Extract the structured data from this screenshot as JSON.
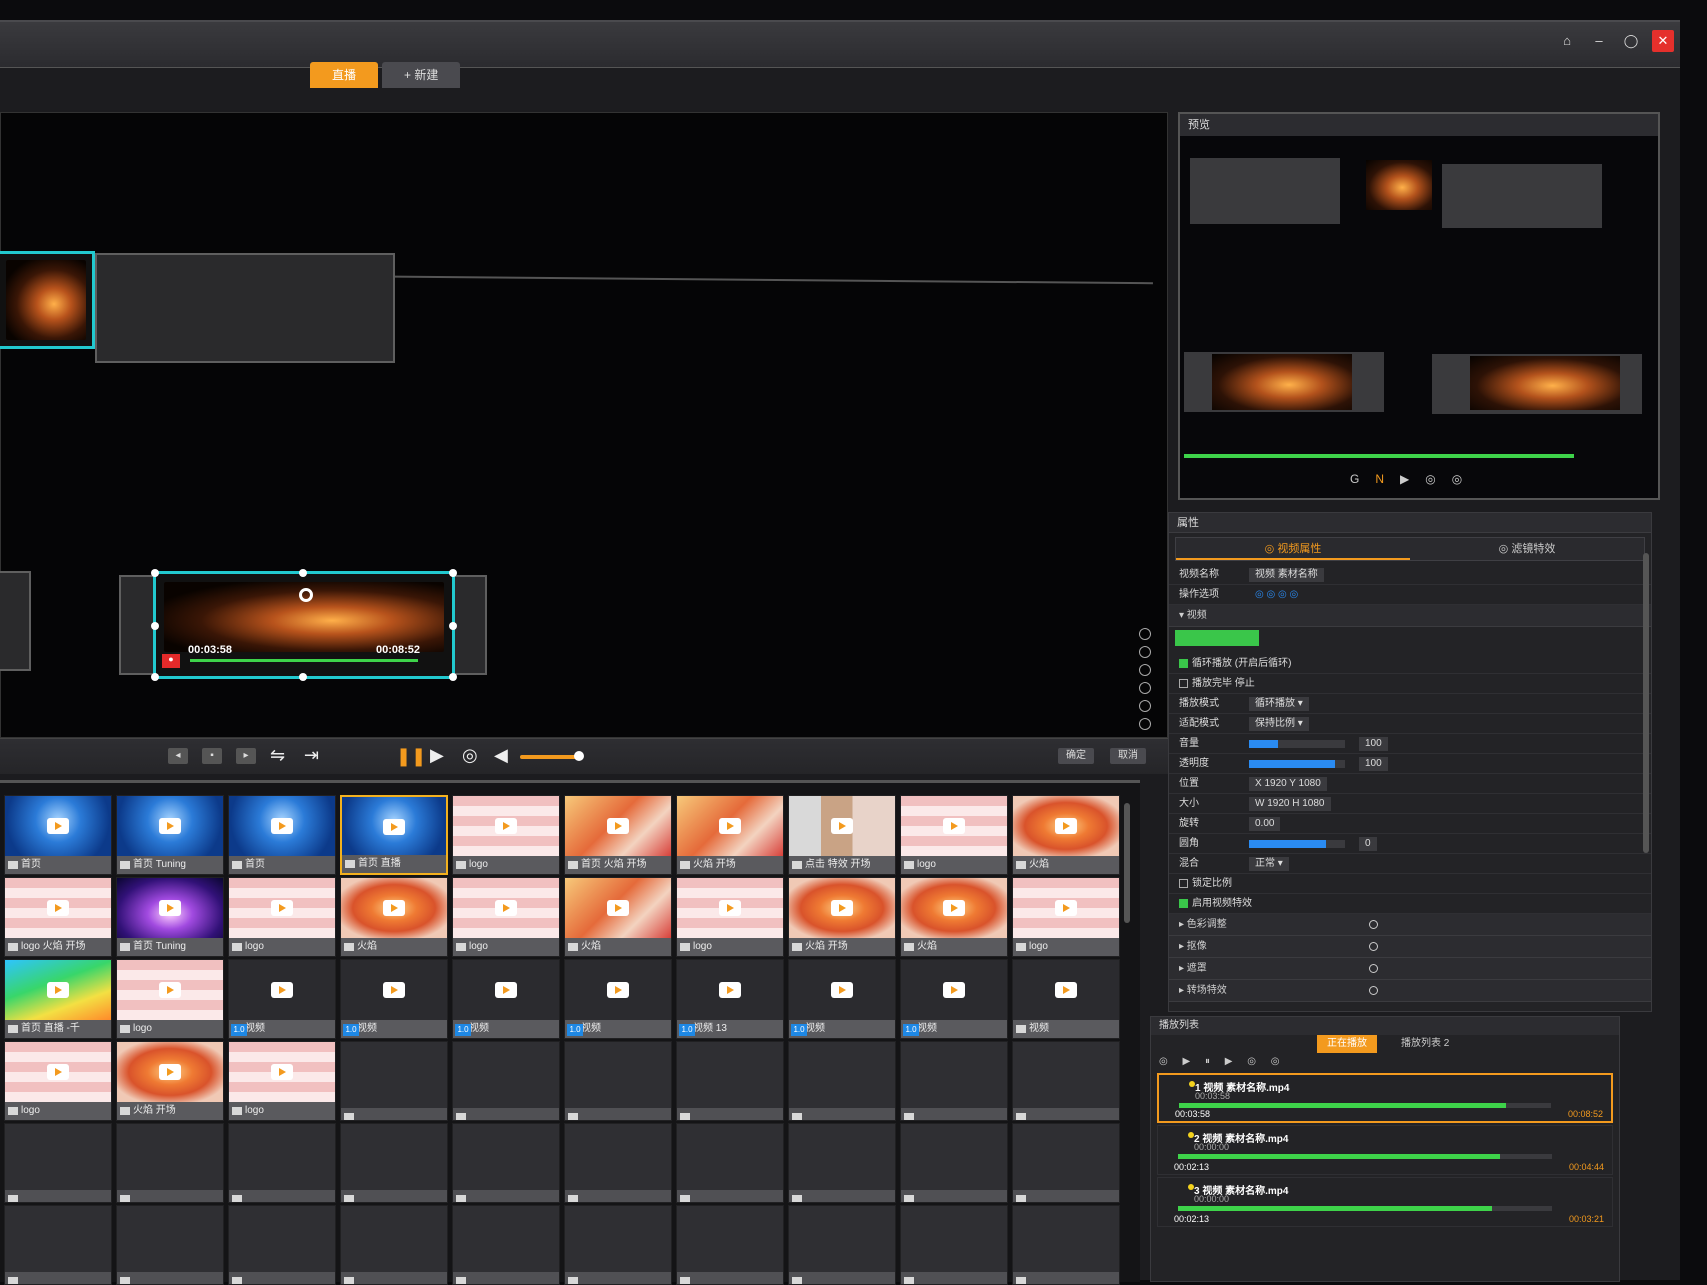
{
  "titlebar": {
    "tabs": [
      {
        "label": "直播"
      },
      {
        "label": "+ 新建"
      }
    ],
    "window_controls": [
      "minimize",
      "restore",
      "close"
    ]
  },
  "stage": {
    "selected_clip": {
      "time_left": "00:03:58",
      "time_right": "00:08:52"
    }
  },
  "transport": {
    "buttons_right": [
      "确定",
      "取消"
    ]
  },
  "media": {
    "items": [
      {
        "label": "首页",
        "art": "blue"
      },
      {
        "label": "首页 Tuning",
        "art": "blue"
      },
      {
        "label": "首页",
        "art": "blue"
      },
      {
        "label": "首页 直播",
        "art": "blue",
        "selected": true
      },
      {
        "label": "logo",
        "art": "pinkstripe"
      },
      {
        "label": "首页 火焰 开场",
        "art": "flame"
      },
      {
        "label": "火焰 开场",
        "art": "flame"
      },
      {
        "label": "点击 特效 开场",
        "art": "mix"
      },
      {
        "label": "logo",
        "art": "pinkstripe"
      },
      {
        "label": "火焰",
        "art": "torch"
      },
      {
        "label": "logo 火焰 开场",
        "art": "pinkstripe"
      },
      {
        "label": "首页 Tuning",
        "art": "purple"
      },
      {
        "label": "logo",
        "art": "pinkstripe"
      },
      {
        "label": "火焰",
        "art": "torch"
      },
      {
        "label": "logo",
        "art": "pinkstripe"
      },
      {
        "label": "火焰",
        "art": "flame"
      },
      {
        "label": "logo",
        "art": "pinkstripe"
      },
      {
        "label": "火焰 开场",
        "art": "torch"
      },
      {
        "label": "火焰",
        "art": "torch"
      },
      {
        "label": "logo",
        "art": "pinkstripe"
      },
      {
        "label": "首页 直播 -千",
        "art": "rainbow"
      },
      {
        "label": "logo",
        "art": "pinkstripe"
      },
      {
        "label": "视频",
        "art": "dark",
        "badge": "1.0"
      },
      {
        "label": "视频",
        "art": "dark",
        "badge": "1.0"
      },
      {
        "label": "视频",
        "art": "dark",
        "badge": "1.0"
      },
      {
        "label": "视频",
        "art": "dark",
        "badge": "1.0"
      },
      {
        "label": "视频 13",
        "art": "dark",
        "badge": "1.0"
      },
      {
        "label": "视频",
        "art": "dark",
        "badge": "1.0"
      },
      {
        "label": "视频",
        "art": "dark",
        "badge": "1.0"
      },
      {
        "label": "视频",
        "art": "dark"
      },
      {
        "label": "logo",
        "art": "pinkstripe"
      },
      {
        "label": "火焰 开场",
        "art": "torch"
      },
      {
        "label": "logo",
        "art": "pinkstripe"
      }
    ]
  },
  "preview": {
    "title": "预览",
    "tool_icons": [
      "G",
      "N",
      "▶",
      "◎",
      "◎"
    ]
  },
  "props": {
    "title": "属性",
    "tabs": [
      "◎ 视频属性",
      "◎ 滤镜特效"
    ],
    "rows": [
      {
        "label": "视频名称",
        "value": "视频 素材名称"
      },
      {
        "label": "操作选项",
        "value": "◎ ◎ ◎ ◎"
      }
    ],
    "section_label": "▾ 视频",
    "checks": [
      {
        "label": "循环播放 (开启后循环)",
        "on": true
      },
      {
        "label": "播放完毕 停止",
        "on": false
      }
    ],
    "settings": [
      {
        "label": "播放模式",
        "value": "循环播放 ▾"
      },
      {
        "label": "适配模式",
        "value": "保持比例 ▾"
      },
      {
        "label": "音量",
        "slider": 0.3,
        "value": "100"
      },
      {
        "label": "透明度",
        "slider": 0.9,
        "value": "100"
      },
      {
        "label": "位置",
        "value": "X 1920   Y 1080"
      },
      {
        "label": "大小",
        "value": "W 1920   H 1080"
      },
      {
        "label": "旋转",
        "value": "0.00"
      },
      {
        "label": "圆角",
        "slider": 0.8,
        "value": "0"
      },
      {
        "label": "混合",
        "value": "正常 ▾"
      }
    ],
    "checks2": [
      {
        "label": "锁定比例",
        "on": false
      },
      {
        "label": "启用视频特效",
        "on": true
      }
    ],
    "sections": [
      "▸ 色彩调整",
      "▸ 抠像",
      "▸ 遮罩",
      "▸ 转场特效"
    ]
  },
  "playlist": {
    "title": "播放列表",
    "tabs": [
      "正在播放",
      "播放列表 2"
    ],
    "tools": "◎ ▶ ⏸ ▶ ◎ ◎",
    "items": [
      {
        "name": "1 视频 素材名称.mp4",
        "sub": "00:03:58",
        "time": "00:03:58",
        "time2": "00:08:52",
        "progress": 0.88,
        "active": true
      },
      {
        "name": "2 视频 素材名称.mp4",
        "sub": "00:00:00",
        "time": "00:02:13",
        "time2": "00:04:44",
        "progress": 0.86,
        "active": false
      },
      {
        "name": "3 视频 素材名称.mp4",
        "sub": "00:00:00",
        "time": "00:02:13",
        "time2": "00:03:21",
        "progress": 0.84,
        "active": false
      }
    ]
  }
}
